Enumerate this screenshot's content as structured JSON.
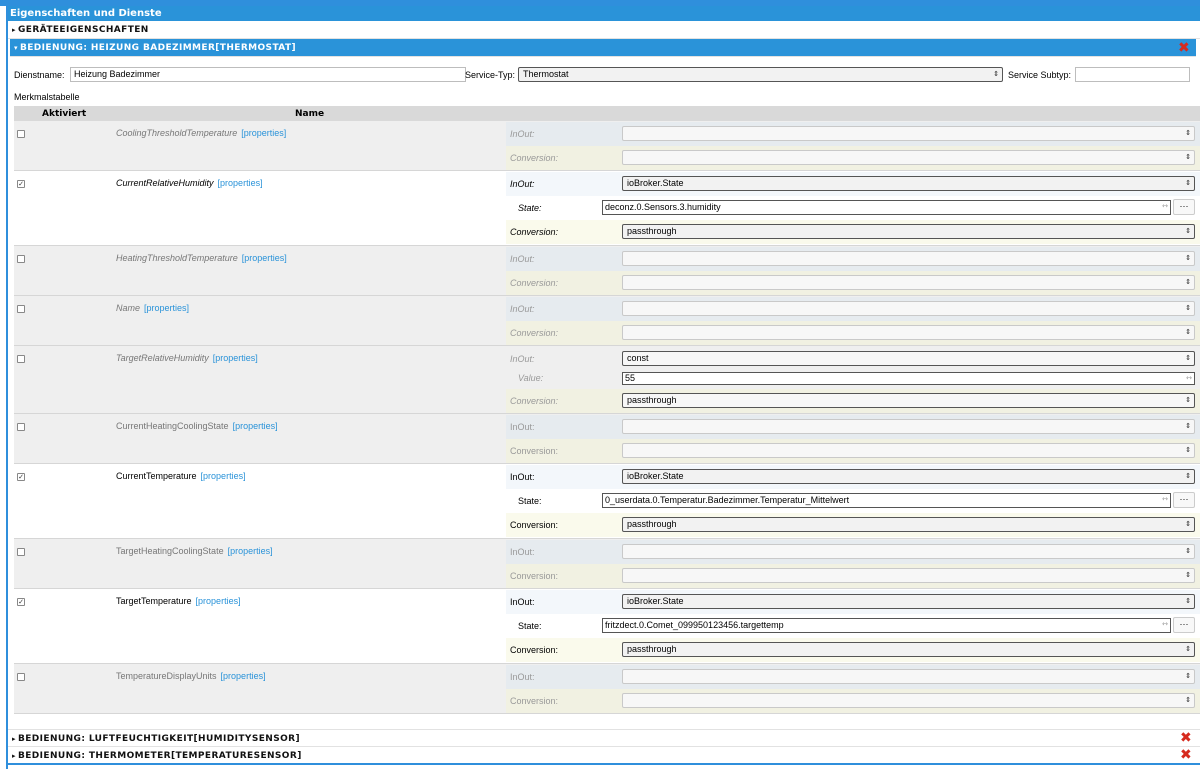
{
  "window": {
    "title": "Eigenschaften und Dienste"
  },
  "sections": {
    "device_props": "Geräteeigenschaften",
    "active": "Bedienung: Heizung Badezimmer[Thermostat]",
    "humidity": "Bedienung: Luftfeuchtigkeit[HumiditySensor]",
    "thermometer": "Bedienung: Thermometer[TemperatureSensor]"
  },
  "form": {
    "service_name_label": "Dienstname:",
    "service_name_value": "Heizung Badezimmer",
    "service_type_label": "Service-Typ:",
    "service_type_value": "Thermostat",
    "service_subtype_label": "Service Subtyp:",
    "service_subtype_value": ""
  },
  "table": {
    "caption": "Merkmalstabelle",
    "col_active": "Aktiviert",
    "col_name": "Name",
    "properties_link": "[properties]",
    "inout_label": "InOut:",
    "conversion_label": "Conversion:",
    "state_label": "State:",
    "value_label": "Value:",
    "dots": "···",
    "rows": [
      {
        "name": "CoolingThresholdTemperature",
        "active": false,
        "inout": "",
        "conversion": ""
      },
      {
        "name": "CurrentRelativeHumidity",
        "active": true,
        "inout": "ioBroker.State",
        "state": "deconz.0.Sensors.3.humidity",
        "conversion": "passthrough"
      },
      {
        "name": "HeatingThresholdTemperature",
        "active": false,
        "inout": "",
        "conversion": ""
      },
      {
        "name": "Name",
        "active": false,
        "inout": "",
        "conversion": ""
      },
      {
        "name": "TargetRelativeHumidity",
        "active": false,
        "inout": "const",
        "value": "55",
        "conversion": "passthrough"
      },
      {
        "name": "CurrentHeatingCoolingState",
        "active": false,
        "inout": "",
        "conversion": ""
      },
      {
        "name": "CurrentTemperature",
        "active": true,
        "inout": "ioBroker.State",
        "state": "0_userdata.0.Temperatur.Badezimmer.Temperatur_Mittelwert",
        "conversion": "passthrough"
      },
      {
        "name": "TargetHeatingCoolingState",
        "active": false,
        "inout": "",
        "conversion": ""
      },
      {
        "name": "TargetTemperature",
        "active": true,
        "inout": "ioBroker.State",
        "state": "fritzdect.0.Comet_099950123456.targettemp",
        "conversion": "passthrough"
      },
      {
        "name": "TemperatureDisplayUnits",
        "active": false,
        "inout": "",
        "conversion": ""
      }
    ]
  },
  "colors": {
    "accent": "#2a93d9",
    "delete": "#d62a1e"
  }
}
